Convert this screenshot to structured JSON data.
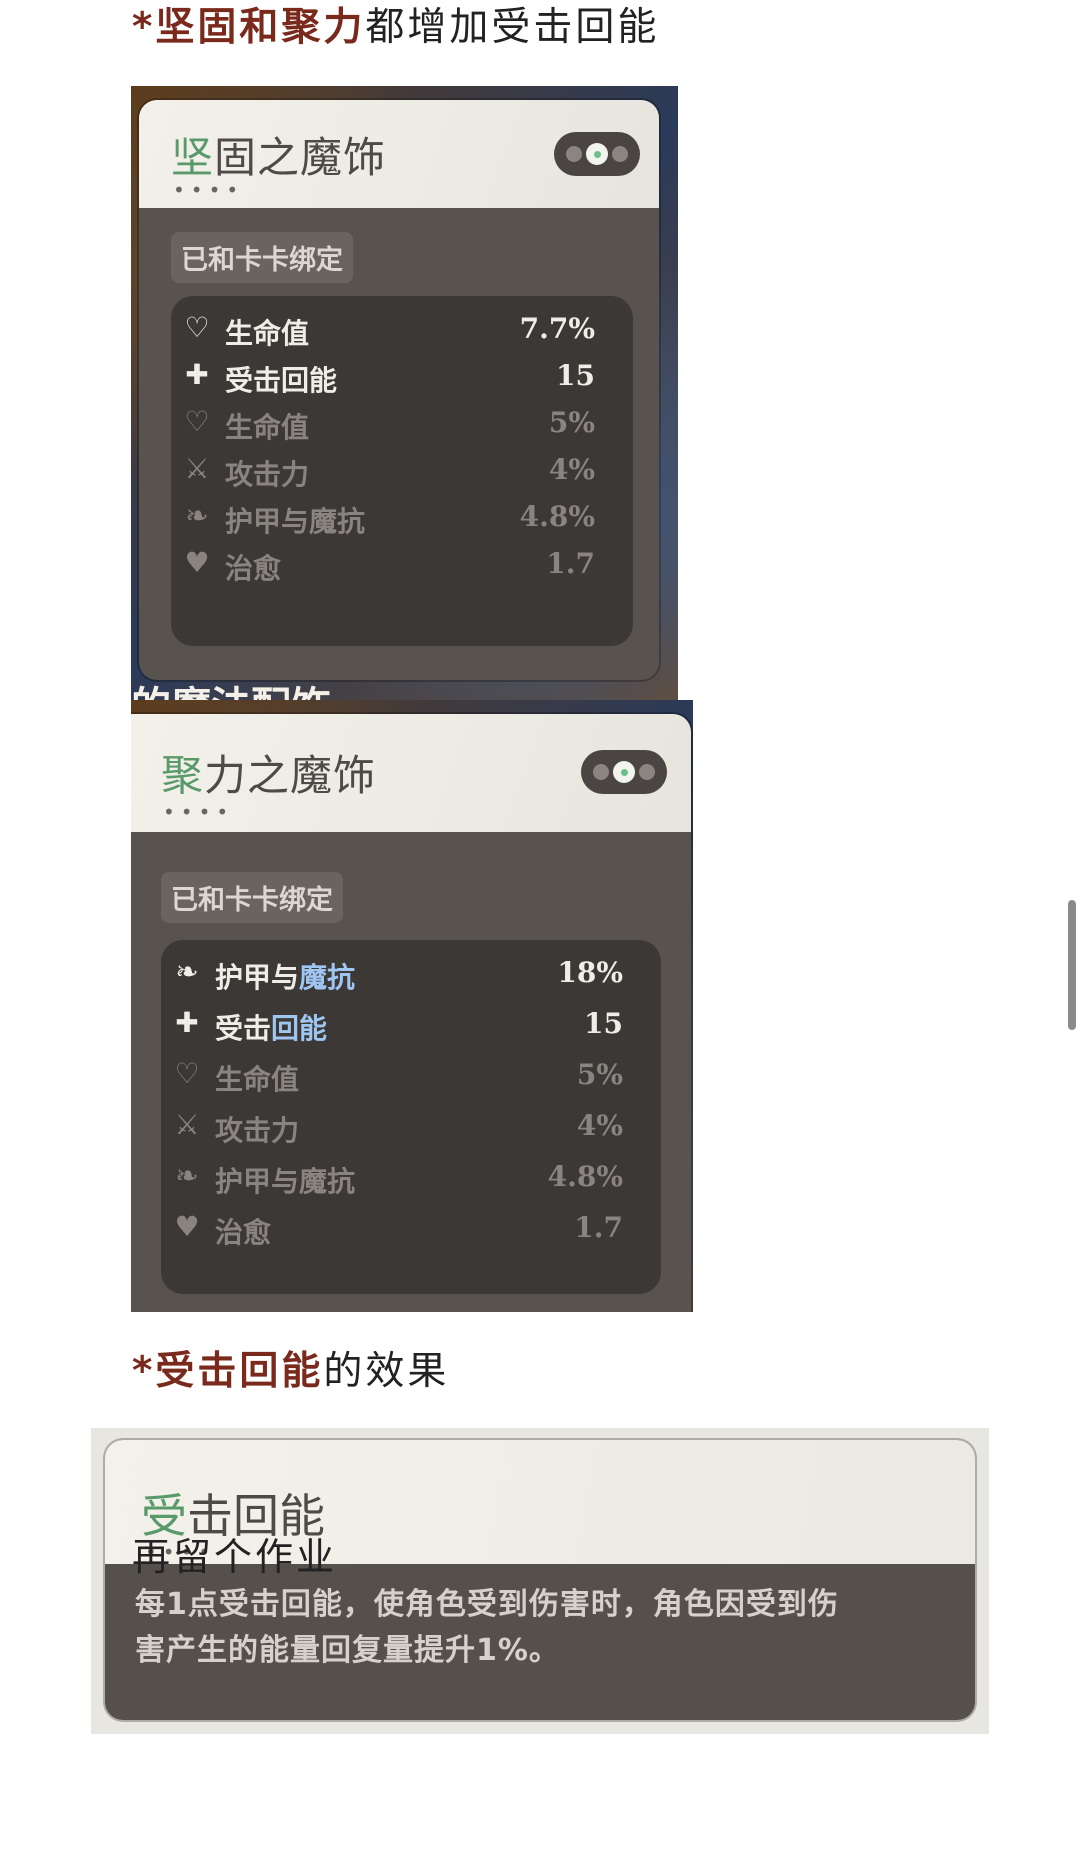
{
  "heading1": {
    "star": "*",
    "highlight": "坚固和聚力",
    "rest": "都增加受击回能"
  },
  "card1": {
    "title_first": "坚",
    "title_rest": "固之魔饰",
    "dots": "••••",
    "bound": "已和卡卡绑定",
    "stats": [
      {
        "icon": "heart-icon",
        "glyph": "♡",
        "name": "生命值",
        "value": "7.7%",
        "style": "main"
      },
      {
        "icon": "muscle-icon",
        "glyph": "✚",
        "name": "受击回能",
        "value": "15",
        "style": "main"
      },
      {
        "icon": "heart-icon",
        "glyph": "♡",
        "name": "生命值",
        "value": "5%",
        "style": "sub"
      },
      {
        "icon": "sword-icon",
        "glyph": "⚔",
        "name": "攻击力",
        "value": "4%",
        "style": "sub"
      },
      {
        "icon": "shield-icon",
        "glyph": "❧",
        "name": "护甲与魔抗",
        "value": "4.8%",
        "style": "sub"
      },
      {
        "icon": "heal-heart-icon",
        "glyph": "♥",
        "name": "治愈",
        "value": "1.7",
        "style": "sub"
      }
    ],
    "peek_text": "的魔法配饰"
  },
  "card2": {
    "title_first": "聚",
    "title_rest": "力之魔饰",
    "dots": "••••",
    "bound": "已和卡卡绑定",
    "stats": [
      {
        "icon": "shield-icon",
        "glyph": "❧",
        "name_a": "护甲与",
        "name_b": "魔抗",
        "value": "18%",
        "style": "main"
      },
      {
        "icon": "muscle-icon",
        "glyph": "✚",
        "name_a": "受击",
        "name_b": "回能",
        "value": "15",
        "style": "main"
      },
      {
        "icon": "heart-icon",
        "glyph": "♡",
        "name_a": "生命值",
        "name_b": "",
        "value": "5%",
        "style": "sub"
      },
      {
        "icon": "sword-icon",
        "glyph": "⚔",
        "name_a": "攻击力",
        "name_b": "",
        "value": "4%",
        "style": "sub"
      },
      {
        "icon": "shield-icon",
        "glyph": "❧",
        "name_a": "护甲与魔抗",
        "name_b": "",
        "value": "4.8%",
        "style": "sub"
      },
      {
        "icon": "heal-heart-icon",
        "glyph": "♥",
        "name_a": "治愈",
        "name_b": "",
        "value": "1.7",
        "style": "sub"
      }
    ]
  },
  "heading2": {
    "star": "*",
    "highlight": "受击回能",
    "rest": "的效果"
  },
  "card3": {
    "title_first": "受",
    "title_rest": "击回能",
    "dots": "••••",
    "desc_line1": "每1点受击回能，使角色受到伤害时，角色因受到伤",
    "desc_line2": "害产生的能量回复量提升1%。"
  },
  "footer": {
    "text": "再留个作业"
  }
}
